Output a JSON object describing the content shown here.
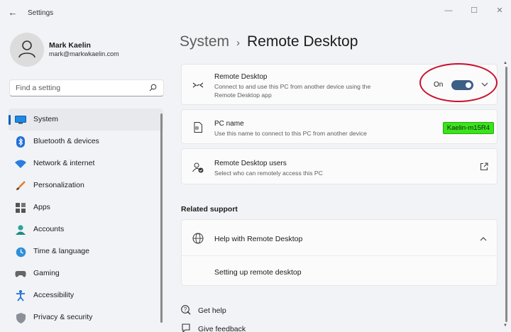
{
  "window": {
    "app_title": "Settings"
  },
  "profile": {
    "name": "Mark Kaelin",
    "email": "mark@markwkaelin.com"
  },
  "search": {
    "placeholder": "Find a setting"
  },
  "nav": {
    "items": [
      {
        "label": "System",
        "icon": "monitor-icon",
        "active": true
      },
      {
        "label": "Bluetooth & devices",
        "icon": "bluetooth-icon"
      },
      {
        "label": "Network & internet",
        "icon": "wifi-icon"
      },
      {
        "label": "Personalization",
        "icon": "brush-icon"
      },
      {
        "label": "Apps",
        "icon": "apps-icon"
      },
      {
        "label": "Accounts",
        "icon": "person-icon"
      },
      {
        "label": "Time & language",
        "icon": "globe-clock-icon"
      },
      {
        "label": "Gaming",
        "icon": "gamepad-icon"
      },
      {
        "label": "Accessibility",
        "icon": "accessibility-icon"
      },
      {
        "label": "Privacy & security",
        "icon": "shield-icon"
      }
    ]
  },
  "breadcrumb": {
    "parent": "System",
    "separator": "›",
    "current": "Remote Desktop"
  },
  "remote_desktop": {
    "title": "Remote Desktop",
    "description": "Connect to and use this PC from another device using the Remote Desktop app",
    "toggle_label": "On",
    "toggle_on": true
  },
  "pc_name": {
    "title": "PC name",
    "description": "Use this name to connect to this PC from another device",
    "value": "Kaelin-m15R4"
  },
  "rd_users": {
    "title": "Remote Desktop users",
    "description": "Select who can remotely access this PC"
  },
  "related_support": {
    "section_title": "Related support",
    "help_title": "Help with Remote Desktop",
    "link": "Setting up remote desktop"
  },
  "footer": {
    "get_help": "Get help",
    "give_feedback": "Give feedback"
  },
  "colors": {
    "accent": "#005fb8",
    "toggle_on": "#3c5f86",
    "badge": "#39e51a",
    "annotation_ring": "#c8102e"
  }
}
